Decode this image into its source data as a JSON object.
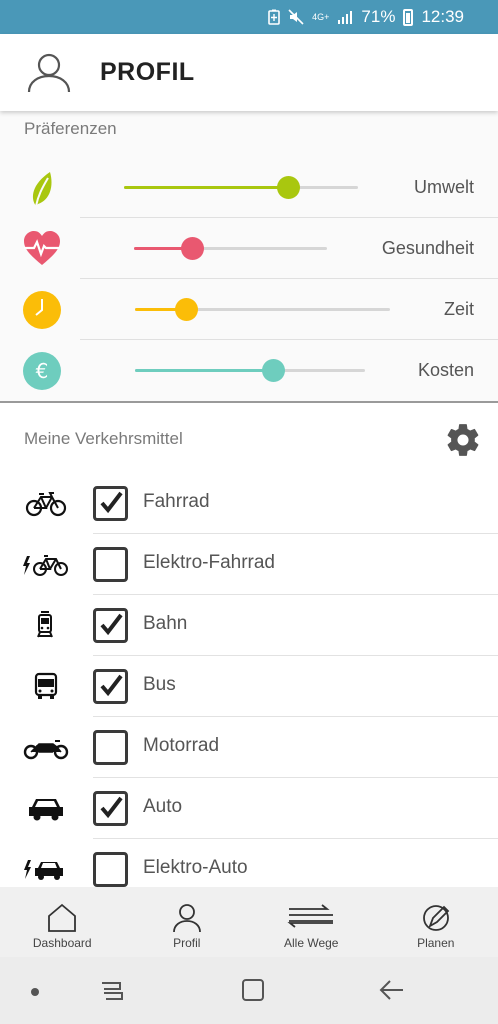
{
  "status_bar": {
    "network": "4G+",
    "battery_percent": "71%",
    "time": "12:39"
  },
  "header": {
    "title": "PROFIL",
    "icon": "user-icon"
  },
  "preferences": {
    "title": "Präferenzen",
    "items": [
      {
        "label": "Umwelt",
        "icon": "leaf-icon",
        "color": "#a9c70f",
        "value": 0.7
      },
      {
        "label": "Gesundheit",
        "icon": "heart-pulse-icon",
        "color": "#e95870",
        "value": 0.3
      },
      {
        "label": "Zeit",
        "icon": "clock-icon",
        "color": "#fbbd08",
        "value": 0.2
      },
      {
        "label": "Kosten",
        "icon": "euro-icon",
        "color": "#6ecdbe",
        "value": 0.6
      }
    ]
  },
  "vehicles": {
    "title": "Meine Verkehrsmittel",
    "settings_icon": "gear-icon",
    "items": [
      {
        "label": "Fahrrad",
        "icon": "bicycle-icon",
        "checked": true
      },
      {
        "label": "Elektro-Fahrrad",
        "icon": "electric-bicycle-icon",
        "checked": false
      },
      {
        "label": "Bahn",
        "icon": "tram-icon",
        "checked": true
      },
      {
        "label": "Bus",
        "icon": "bus-icon",
        "checked": true
      },
      {
        "label": "Motorrad",
        "icon": "motorcycle-icon",
        "checked": false
      },
      {
        "label": "Auto",
        "icon": "car-icon",
        "checked": true
      },
      {
        "label": "Elektro-Auto",
        "icon": "electric-car-icon",
        "checked": false
      }
    ]
  },
  "bottom_nav": {
    "items": [
      {
        "label": "Dashboard",
        "icon": "home-icon"
      },
      {
        "label": "Profil",
        "icon": "user-icon"
      },
      {
        "label": "Alle Wege",
        "icon": "routes-icon"
      },
      {
        "label": "Planen",
        "icon": "pen-icon"
      }
    ]
  }
}
